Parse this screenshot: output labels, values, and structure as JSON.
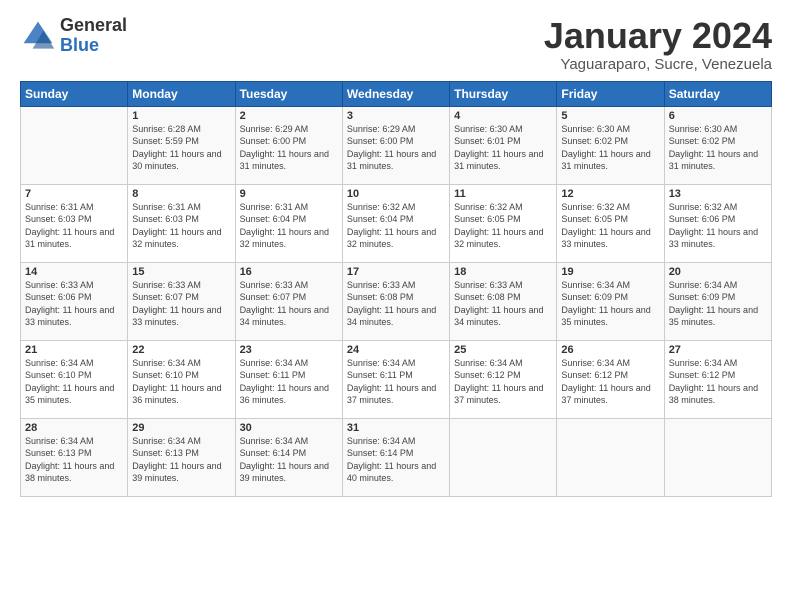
{
  "header": {
    "logo_general": "General",
    "logo_blue": "Blue",
    "title": "January 2024",
    "subtitle": "Yaguaraparo, Sucre, Venezuela"
  },
  "days_of_week": [
    "Sunday",
    "Monday",
    "Tuesday",
    "Wednesday",
    "Thursday",
    "Friday",
    "Saturday"
  ],
  "weeks": [
    [
      {
        "day": "",
        "sunrise": "",
        "sunset": "",
        "daylight": ""
      },
      {
        "day": "1",
        "sunrise": "Sunrise: 6:28 AM",
        "sunset": "Sunset: 5:59 PM",
        "daylight": "Daylight: 11 hours and 30 minutes."
      },
      {
        "day": "2",
        "sunrise": "Sunrise: 6:29 AM",
        "sunset": "Sunset: 6:00 PM",
        "daylight": "Daylight: 11 hours and 31 minutes."
      },
      {
        "day": "3",
        "sunrise": "Sunrise: 6:29 AM",
        "sunset": "Sunset: 6:00 PM",
        "daylight": "Daylight: 11 hours and 31 minutes."
      },
      {
        "day": "4",
        "sunrise": "Sunrise: 6:30 AM",
        "sunset": "Sunset: 6:01 PM",
        "daylight": "Daylight: 11 hours and 31 minutes."
      },
      {
        "day": "5",
        "sunrise": "Sunrise: 6:30 AM",
        "sunset": "Sunset: 6:02 PM",
        "daylight": "Daylight: 11 hours and 31 minutes."
      },
      {
        "day": "6",
        "sunrise": "Sunrise: 6:30 AM",
        "sunset": "Sunset: 6:02 PM",
        "daylight": "Daylight: 11 hours and 31 minutes."
      }
    ],
    [
      {
        "day": "7",
        "sunrise": "Sunrise: 6:31 AM",
        "sunset": "Sunset: 6:03 PM",
        "daylight": "Daylight: 11 hours and 31 minutes."
      },
      {
        "day": "8",
        "sunrise": "Sunrise: 6:31 AM",
        "sunset": "Sunset: 6:03 PM",
        "daylight": "Daylight: 11 hours and 32 minutes."
      },
      {
        "day": "9",
        "sunrise": "Sunrise: 6:31 AM",
        "sunset": "Sunset: 6:04 PM",
        "daylight": "Daylight: 11 hours and 32 minutes."
      },
      {
        "day": "10",
        "sunrise": "Sunrise: 6:32 AM",
        "sunset": "Sunset: 6:04 PM",
        "daylight": "Daylight: 11 hours and 32 minutes."
      },
      {
        "day": "11",
        "sunrise": "Sunrise: 6:32 AM",
        "sunset": "Sunset: 6:05 PM",
        "daylight": "Daylight: 11 hours and 32 minutes."
      },
      {
        "day": "12",
        "sunrise": "Sunrise: 6:32 AM",
        "sunset": "Sunset: 6:05 PM",
        "daylight": "Daylight: 11 hours and 33 minutes."
      },
      {
        "day": "13",
        "sunrise": "Sunrise: 6:32 AM",
        "sunset": "Sunset: 6:06 PM",
        "daylight": "Daylight: 11 hours and 33 minutes."
      }
    ],
    [
      {
        "day": "14",
        "sunrise": "Sunrise: 6:33 AM",
        "sunset": "Sunset: 6:06 PM",
        "daylight": "Daylight: 11 hours and 33 minutes."
      },
      {
        "day": "15",
        "sunrise": "Sunrise: 6:33 AM",
        "sunset": "Sunset: 6:07 PM",
        "daylight": "Daylight: 11 hours and 33 minutes."
      },
      {
        "day": "16",
        "sunrise": "Sunrise: 6:33 AM",
        "sunset": "Sunset: 6:07 PM",
        "daylight": "Daylight: 11 hours and 34 minutes."
      },
      {
        "day": "17",
        "sunrise": "Sunrise: 6:33 AM",
        "sunset": "Sunset: 6:08 PM",
        "daylight": "Daylight: 11 hours and 34 minutes."
      },
      {
        "day": "18",
        "sunrise": "Sunrise: 6:33 AM",
        "sunset": "Sunset: 6:08 PM",
        "daylight": "Daylight: 11 hours and 34 minutes."
      },
      {
        "day": "19",
        "sunrise": "Sunrise: 6:34 AM",
        "sunset": "Sunset: 6:09 PM",
        "daylight": "Daylight: 11 hours and 35 minutes."
      },
      {
        "day": "20",
        "sunrise": "Sunrise: 6:34 AM",
        "sunset": "Sunset: 6:09 PM",
        "daylight": "Daylight: 11 hours and 35 minutes."
      }
    ],
    [
      {
        "day": "21",
        "sunrise": "Sunrise: 6:34 AM",
        "sunset": "Sunset: 6:10 PM",
        "daylight": "Daylight: 11 hours and 35 minutes."
      },
      {
        "day": "22",
        "sunrise": "Sunrise: 6:34 AM",
        "sunset": "Sunset: 6:10 PM",
        "daylight": "Daylight: 11 hours and 36 minutes."
      },
      {
        "day": "23",
        "sunrise": "Sunrise: 6:34 AM",
        "sunset": "Sunset: 6:11 PM",
        "daylight": "Daylight: 11 hours and 36 minutes."
      },
      {
        "day": "24",
        "sunrise": "Sunrise: 6:34 AM",
        "sunset": "Sunset: 6:11 PM",
        "daylight": "Daylight: 11 hours and 37 minutes."
      },
      {
        "day": "25",
        "sunrise": "Sunrise: 6:34 AM",
        "sunset": "Sunset: 6:12 PM",
        "daylight": "Daylight: 11 hours and 37 minutes."
      },
      {
        "day": "26",
        "sunrise": "Sunrise: 6:34 AM",
        "sunset": "Sunset: 6:12 PM",
        "daylight": "Daylight: 11 hours and 37 minutes."
      },
      {
        "day": "27",
        "sunrise": "Sunrise: 6:34 AM",
        "sunset": "Sunset: 6:12 PM",
        "daylight": "Daylight: 11 hours and 38 minutes."
      }
    ],
    [
      {
        "day": "28",
        "sunrise": "Sunrise: 6:34 AM",
        "sunset": "Sunset: 6:13 PM",
        "daylight": "Daylight: 11 hours and 38 minutes."
      },
      {
        "day": "29",
        "sunrise": "Sunrise: 6:34 AM",
        "sunset": "Sunset: 6:13 PM",
        "daylight": "Daylight: 11 hours and 39 minutes."
      },
      {
        "day": "30",
        "sunrise": "Sunrise: 6:34 AM",
        "sunset": "Sunset: 6:14 PM",
        "daylight": "Daylight: 11 hours and 39 minutes."
      },
      {
        "day": "31",
        "sunrise": "Sunrise: 6:34 AM",
        "sunset": "Sunset: 6:14 PM",
        "daylight": "Daylight: 11 hours and 40 minutes."
      },
      {
        "day": "",
        "sunrise": "",
        "sunset": "",
        "daylight": ""
      },
      {
        "day": "",
        "sunrise": "",
        "sunset": "",
        "daylight": ""
      },
      {
        "day": "",
        "sunrise": "",
        "sunset": "",
        "daylight": ""
      }
    ]
  ]
}
